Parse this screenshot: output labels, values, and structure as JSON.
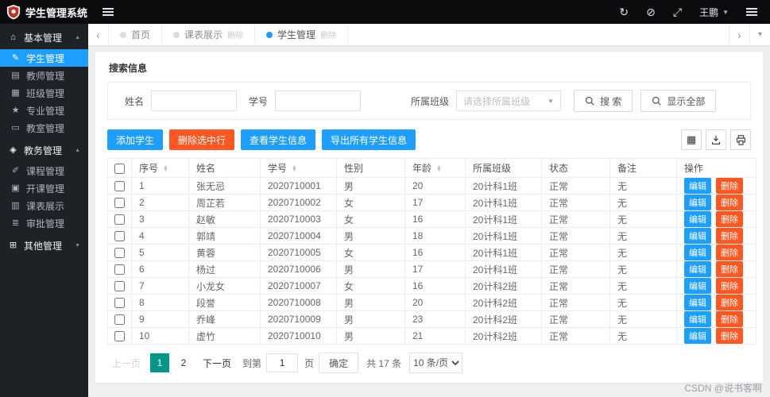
{
  "app": {
    "title": "学生管理系统"
  },
  "topbar": {
    "user": "王鹏",
    "icons": [
      {
        "name": "refresh-icon",
        "glyph": "↻"
      },
      {
        "name": "clear-cache-icon",
        "glyph": "⊘"
      },
      {
        "name": "fullscreen-icon",
        "glyph": "⤢"
      }
    ]
  },
  "sidebar": {
    "sections": [
      {
        "label": "基本管理",
        "icon": "⌂",
        "expanded": true,
        "items": [
          {
            "key": "students",
            "label": "学生管理",
            "icon": "✎",
            "active": true
          },
          {
            "key": "teachers",
            "label": "教师管理",
            "icon": "▤",
            "active": false
          },
          {
            "key": "classes",
            "label": "班级管理",
            "icon": "▦",
            "active": false
          },
          {
            "key": "majors",
            "label": "专业管理",
            "icon": "★",
            "active": false
          },
          {
            "key": "classrooms",
            "label": "教室管理",
            "icon": "▭",
            "active": false
          }
        ]
      },
      {
        "label": "教务管理",
        "icon": "◈",
        "expanded": true,
        "items": [
          {
            "key": "courses",
            "label": "课程管理",
            "icon": "✐",
            "active": false
          },
          {
            "key": "course-offering",
            "label": "开课管理",
            "icon": "▣",
            "active": false
          },
          {
            "key": "timetable",
            "label": "课表展示",
            "icon": "▥",
            "active": false
          },
          {
            "key": "approval",
            "label": "审批管理",
            "icon": "≣",
            "active": false
          }
        ]
      },
      {
        "label": "其他管理",
        "icon": "⊞",
        "expanded": false,
        "items": []
      }
    ]
  },
  "tabs": [
    {
      "label": "首页",
      "close": "",
      "active": false
    },
    {
      "label": "课表展示",
      "close": "删除",
      "active": false
    },
    {
      "label": "学生管理",
      "close": "删除",
      "active": true
    }
  ],
  "search": {
    "title": "搜索信息",
    "name_label": "姓名",
    "name_value": "",
    "sid_label": "学号",
    "sid_value": "",
    "class_label": "所属班级",
    "class_placeholder": "请选择所属班级",
    "search_button": "搜  索",
    "show_all_button": "显示全部"
  },
  "toolbar": {
    "add": "添加学生",
    "delete_selected": "删除选中行",
    "view": "查看学生信息",
    "export": "导出所有学生信息"
  },
  "table": {
    "headers": [
      "序号",
      "姓名",
      "学号",
      "性别",
      "年龄",
      "所属班级",
      "状态",
      "备注",
      "操作"
    ],
    "sortable": [
      "序号",
      "学号",
      "年龄"
    ],
    "edit_label": "编辑",
    "delete_label": "删除",
    "rows": [
      {
        "seq": "1",
        "name": "张无忌",
        "sid": "2020710001",
        "gender": "男",
        "age": "20",
        "class": "20计科1班",
        "status": "正常",
        "remark": "无"
      },
      {
        "seq": "2",
        "name": "周芷若",
        "sid": "2020710002",
        "gender": "女",
        "age": "17",
        "class": "20计科1班",
        "status": "正常",
        "remark": "无"
      },
      {
        "seq": "3",
        "name": "赵敏",
        "sid": "2020710003",
        "gender": "女",
        "age": "16",
        "class": "20计科1班",
        "status": "正常",
        "remark": "无"
      },
      {
        "seq": "4",
        "name": "郭靖",
        "sid": "2020710004",
        "gender": "男",
        "age": "18",
        "class": "20计科1班",
        "status": "正常",
        "remark": "无"
      },
      {
        "seq": "5",
        "name": "黄蓉",
        "sid": "2020710005",
        "gender": "女",
        "age": "16",
        "class": "20计科1班",
        "status": "正常",
        "remark": "无"
      },
      {
        "seq": "6",
        "name": "杨过",
        "sid": "2020710006",
        "gender": "男",
        "age": "17",
        "class": "20计科1班",
        "status": "正常",
        "remark": "无"
      },
      {
        "seq": "7",
        "name": "小龙女",
        "sid": "2020710007",
        "gender": "女",
        "age": "16",
        "class": "20计科2班",
        "status": "正常",
        "remark": "无"
      },
      {
        "seq": "8",
        "name": "段誉",
        "sid": "2020710008",
        "gender": "男",
        "age": "20",
        "class": "20计科2班",
        "status": "正常",
        "remark": "无"
      },
      {
        "seq": "9",
        "name": "乔峰",
        "sid": "2020710009",
        "gender": "男",
        "age": "23",
        "class": "20计科2班",
        "status": "正常",
        "remark": "无"
      },
      {
        "seq": "10",
        "name": "虚竹",
        "sid": "2020710010",
        "gender": "男",
        "age": "21",
        "class": "20计科2班",
        "status": "正常",
        "remark": "无"
      }
    ]
  },
  "pagination": {
    "prev": "上一页",
    "pages": [
      "1",
      "2"
    ],
    "active_page": "1",
    "next": "下一页",
    "goto_label": "到第",
    "goto_value": "1",
    "page_suffix": "页",
    "confirm": "确定",
    "total": "共 17 条",
    "page_size": "10 条/页"
  },
  "watermark": "CSDN @说书客啊",
  "colors": {
    "primary": "#1E9FFF",
    "danger": "#FF5722",
    "pager_active": "#009688",
    "topbar_bg": "#0c0c0f",
    "sidebar_bg": "#1e2126"
  }
}
